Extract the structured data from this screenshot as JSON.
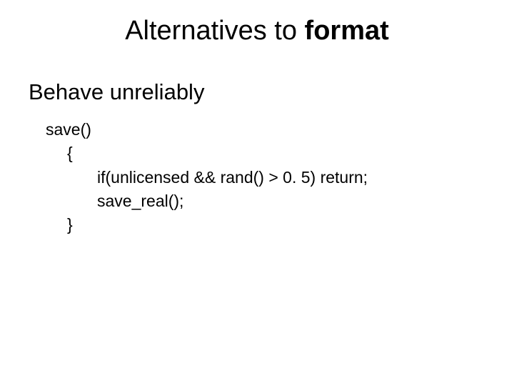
{
  "title_prefix": "Alternatives to ",
  "title_bold": "format",
  "subtitle": "Behave unreliably",
  "code": {
    "l1": "save()",
    "l2": "{",
    "l3": "if(unlicensed && rand() > 0. 5) return;",
    "l4": "save_real();",
    "l5": "}"
  }
}
